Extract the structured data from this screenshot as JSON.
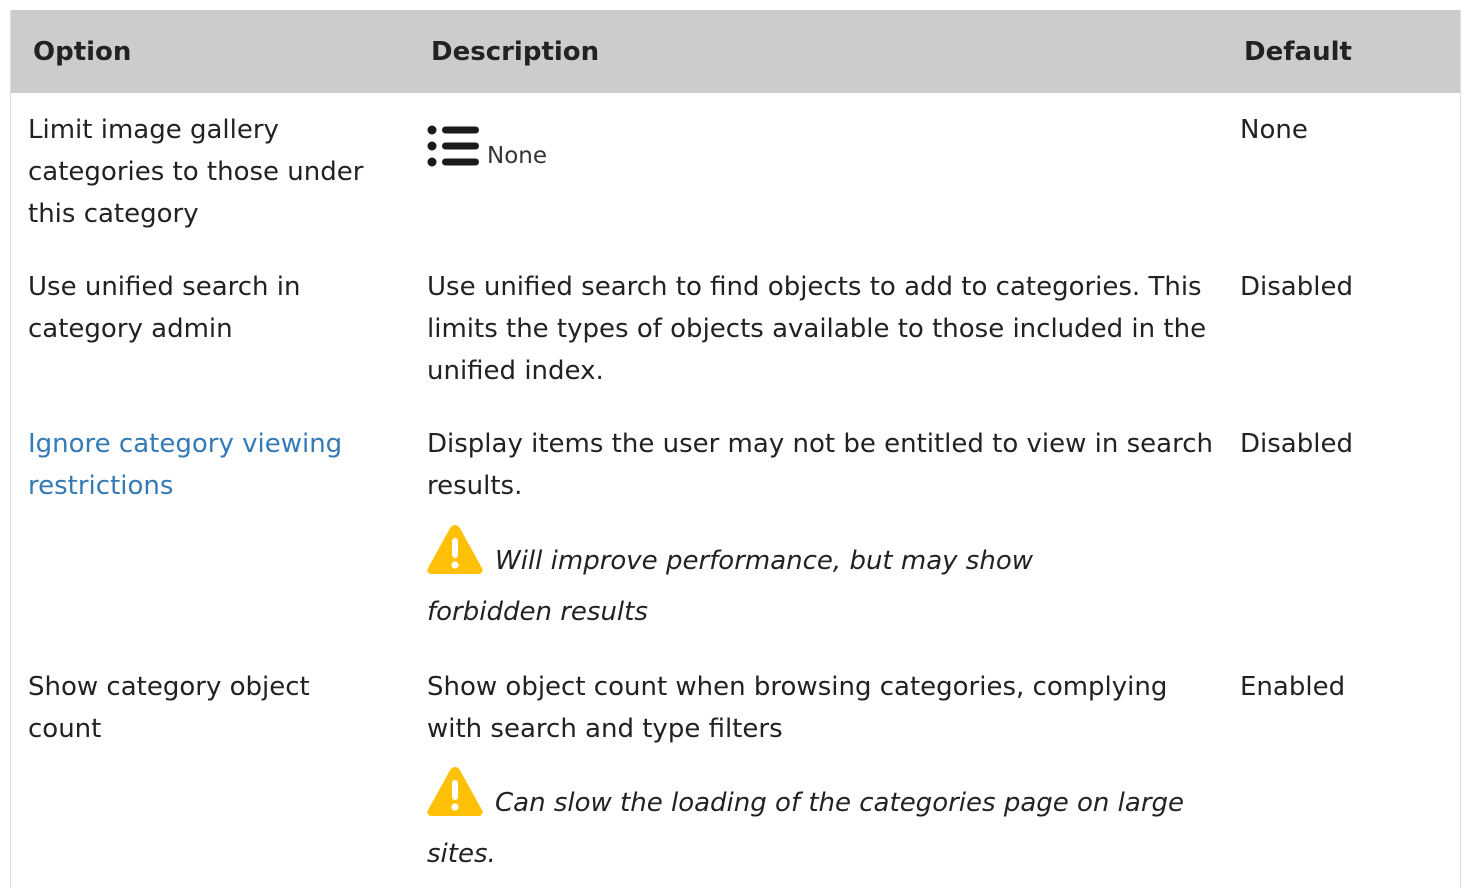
{
  "table": {
    "headers": {
      "option": "Option",
      "description": "Description",
      "default": "Default"
    },
    "rows": [
      {
        "option": "Limit image gallery categories to those under this category",
        "description": "None",
        "default": "None",
        "icon": "list-icon"
      },
      {
        "option": "Use unified search in category admin",
        "description": "Use unified search to find objects to add to categories. This limits the types of objects available to those included in the unified index.",
        "default": "Disabled"
      },
      {
        "option": "Ignore category viewing restrictions",
        "description": "Display items the user may not be entitled to view in search results.",
        "warning": "Will improve performance, but may show forbidden results",
        "default": "Disabled",
        "option_is_link": true
      },
      {
        "option": "Show category object count",
        "description": "Show object count when browsing categories, complying with search and type filters",
        "warning": "Can slow the loading of the categories page on large sites.",
        "default": "Enabled"
      }
    ]
  },
  "colors": {
    "header_bg": "#cccccc",
    "link": "#337ab7",
    "warning_icon": "#ffc107",
    "text": "#222222"
  }
}
